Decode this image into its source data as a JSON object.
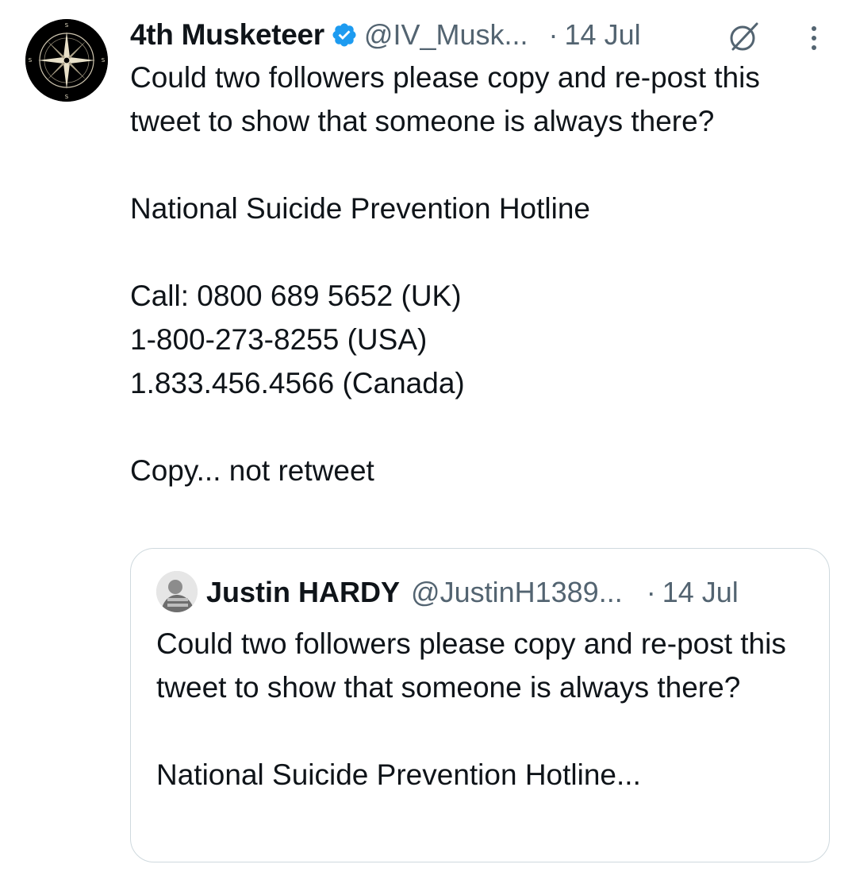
{
  "tweet": {
    "author_name": "4th Musketeer",
    "handle": "@IV_Musk...",
    "separator": "·",
    "date": "14 Jul",
    "verified": true,
    "avatar_icon": "compass-rose-icon",
    "body": {
      "line1": "Could two followers please copy and re-post this tweet to show that someone is always there?",
      "line2": "National Suicide Prevention Hotline",
      "line3": "Call: 0800 689 5652 (UK)",
      "line4": "1-800-273-8255 (USA)",
      "line5": "1.833.456.4566 (Canada)",
      "line6": "Copy... not retweet"
    }
  },
  "quoted_tweet": {
    "author_name": "Justin HARDY",
    "handle": "@JustinH1389...",
    "separator": "·",
    "date": "14 Jul",
    "body": {
      "line1": "Could two followers please copy and re-post this tweet to show that someone is always there?",
      "line2": "National Suicide Prevention Hotline..."
    }
  },
  "colors": {
    "text_primary": "#0f1419",
    "text_secondary": "#536471",
    "verified_blue": "#1d9bf0",
    "card_border": "#cfd9de"
  }
}
